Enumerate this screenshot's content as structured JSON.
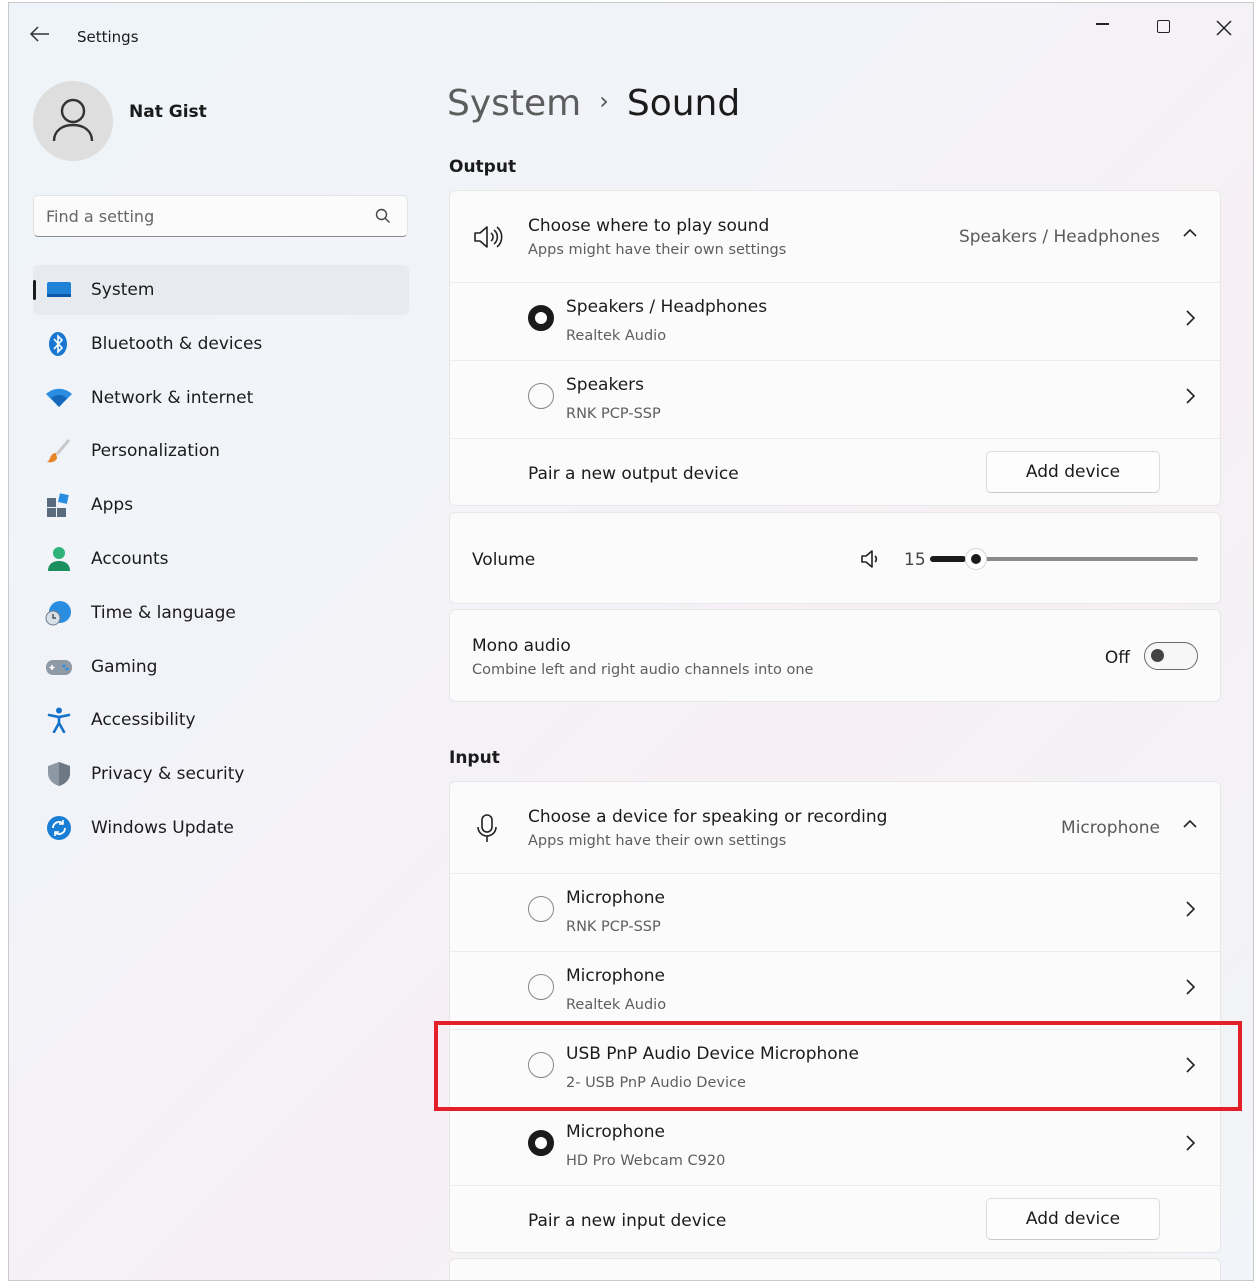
{
  "window": {
    "title": "Settings",
    "controls": {
      "minimize": "minimize-icon",
      "maximize": "maximize-icon",
      "close": "close-icon"
    }
  },
  "profile": {
    "name": "Nat Gist"
  },
  "search": {
    "placeholder": "Find a setting"
  },
  "sidebar": {
    "items": [
      {
        "label": "System",
        "icon": "system-icon",
        "active": true
      },
      {
        "label": "Bluetooth & devices",
        "icon": "bluetooth-icon"
      },
      {
        "label": "Network & internet",
        "icon": "wifi-icon"
      },
      {
        "label": "Personalization",
        "icon": "brush-icon"
      },
      {
        "label": "Apps",
        "icon": "apps-icon"
      },
      {
        "label": "Accounts",
        "icon": "accounts-icon"
      },
      {
        "label": "Time & language",
        "icon": "globe-clock-icon"
      },
      {
        "label": "Gaming",
        "icon": "gamepad-icon"
      },
      {
        "label": "Accessibility",
        "icon": "accessibility-icon"
      },
      {
        "label": "Privacy & security",
        "icon": "shield-icon"
      },
      {
        "label": "Windows Update",
        "icon": "update-icon"
      }
    ]
  },
  "breadcrumb": {
    "parent": "System",
    "separator": "›",
    "current": "Sound"
  },
  "output": {
    "section_title": "Output",
    "header": {
      "title": "Choose where to play sound",
      "subtitle": "Apps might have their own settings",
      "value": "Speakers / Headphones"
    },
    "devices": [
      {
        "name": "Speakers / Headphones",
        "detail": "Realtek Audio",
        "selected": true
      },
      {
        "name": "Speakers",
        "detail": "RNK PCP-SSP",
        "selected": false
      }
    ],
    "pair": {
      "label": "Pair a new output device",
      "button": "Add device"
    }
  },
  "volume": {
    "label": "Volume",
    "value": "15"
  },
  "mono": {
    "title": "Mono audio",
    "subtitle": "Combine left and right audio channels into one",
    "state": "Off"
  },
  "input": {
    "section_title": "Input",
    "header": {
      "title": "Choose a device for speaking or recording",
      "subtitle": "Apps might have their own settings",
      "value": "Microphone"
    },
    "devices": [
      {
        "name": "Microphone",
        "detail": "RNK PCP-SSP",
        "selected": false
      },
      {
        "name": "Microphone",
        "detail": "Realtek Audio",
        "selected": false
      },
      {
        "name": "USB PnP Audio Device Microphone",
        "detail": "2- USB PnP Audio Device",
        "selected": false
      },
      {
        "name": "Microphone",
        "detail": "HD Pro Webcam C920",
        "selected": true
      }
    ],
    "pair": {
      "label": "Pair a new input device",
      "button": "Add device"
    }
  },
  "colors": {
    "accent": "#0067c0",
    "highlight_box": "#e3202a"
  }
}
